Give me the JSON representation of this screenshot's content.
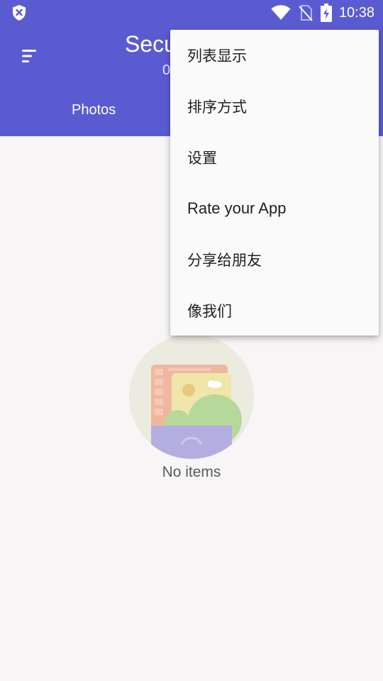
{
  "status_bar": {
    "time": "10:38",
    "icons": [
      "shield-x-icon",
      "wifi-icon",
      "no-sim-icon",
      "battery-charging-icon"
    ]
  },
  "app_bar": {
    "title": "Secu",
    "subtitle": "0",
    "menu_icon": "menu-lines-icon"
  },
  "tabs": [
    {
      "label": "Photos"
    }
  ],
  "empty_state": {
    "text": "No items",
    "illustration": "empty-gallery-illustration"
  },
  "overflow_menu": {
    "items": [
      {
        "label": "列表显示"
      },
      {
        "label": "排序方式"
      },
      {
        "label": "设置"
      },
      {
        "label": "Rate your App"
      },
      {
        "label": "分享给朋友"
      },
      {
        "label": "像我们"
      }
    ]
  },
  "colors": {
    "primary": "#5b5bd1",
    "background": "#f7f5f6",
    "menu_background": "#fafafa"
  }
}
